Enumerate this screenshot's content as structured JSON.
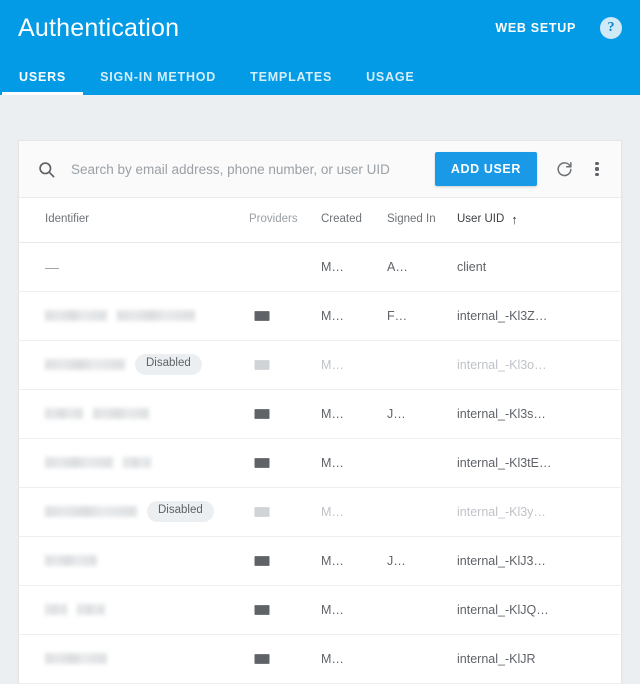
{
  "appbar": {
    "title": "Authentication",
    "web_setup_label": "WEB SETUP",
    "help_label": "?",
    "help_icon": "help-circle-icon",
    "bg_color": "#039be5"
  },
  "tabs": [
    {
      "label": "USERS",
      "active": true
    },
    {
      "label": "SIGN-IN METHOD",
      "active": false
    },
    {
      "label": "TEMPLATES",
      "active": false
    },
    {
      "label": "USAGE",
      "active": false
    }
  ],
  "toolbar": {
    "search_icon": "search-icon",
    "search_placeholder": "Search by email address, phone number, or user UID",
    "search_value": "",
    "add_user_label": "ADD USER",
    "add_user_color": "#1a99e6",
    "refresh_icon": "refresh-icon",
    "overflow_icon": "more-vert-icon"
  },
  "table": {
    "columns": [
      {
        "key": "identifier",
        "label": "Identifier"
      },
      {
        "key": "providers",
        "label": "Providers"
      },
      {
        "key": "created",
        "label": "Created"
      },
      {
        "key": "signed_in",
        "label": "Signed In"
      },
      {
        "key": "user_uid",
        "label": "User UID"
      }
    ],
    "sort": {
      "column": "User UID",
      "direction": "asc",
      "arrow": "↑"
    },
    "rows": [
      {
        "identifier_redacted": false,
        "identifier_text": "—",
        "redact_widths": [],
        "disabled": false,
        "provider_icon": "",
        "created": "M…",
        "signed_in": "A…",
        "user_uid": "client"
      },
      {
        "identifier_redacted": true,
        "identifier_text": "",
        "redact_widths": [
          62,
          78
        ],
        "disabled": false,
        "provider_icon": "email-icon",
        "created": "M…",
        "signed_in": "F…",
        "user_uid": "internal_-Kl3Z…"
      },
      {
        "identifier_redacted": true,
        "identifier_text": "",
        "redact_widths": [
          80
        ],
        "disabled": true,
        "disabled_label": "Disabled",
        "provider_icon": "email-icon",
        "created": "M…",
        "signed_in": "",
        "user_uid": "internal_-Kl3o…"
      },
      {
        "identifier_redacted": true,
        "identifier_text": "",
        "redact_widths": [
          38,
          56
        ],
        "disabled": false,
        "provider_icon": "email-icon",
        "created": "M…",
        "signed_in": "J…",
        "user_uid": "internal_-Kl3s…"
      },
      {
        "identifier_redacted": true,
        "identifier_text": "",
        "redact_widths": [
          68,
          28
        ],
        "disabled": false,
        "provider_icon": "email-icon",
        "created": "M…",
        "signed_in": "",
        "user_uid": "internal_-Kl3tE…"
      },
      {
        "identifier_redacted": true,
        "identifier_text": "",
        "redact_widths": [
          92
        ],
        "disabled": true,
        "disabled_label": "Disabled",
        "provider_icon": "email-icon",
        "created": "M…",
        "signed_in": "",
        "user_uid": "internal_-Kl3y…"
      },
      {
        "identifier_redacted": true,
        "identifier_text": "",
        "redact_widths": [
          52
        ],
        "disabled": false,
        "provider_icon": "email-icon",
        "created": "M…",
        "signed_in": "J…",
        "user_uid": "internal_-KlJ3…"
      },
      {
        "identifier_redacted": true,
        "identifier_text": "",
        "redact_widths": [
          22,
          28
        ],
        "disabled": false,
        "provider_icon": "email-icon",
        "created": "M…",
        "signed_in": "",
        "user_uid": "internal_-KlJQ…"
      },
      {
        "identifier_redacted": true,
        "identifier_text": "",
        "redact_widths": [
          62
        ],
        "disabled": false,
        "provider_icon": "email-icon",
        "created": "M…",
        "signed_in": "",
        "user_uid": "internal_-KlJR"
      }
    ]
  }
}
